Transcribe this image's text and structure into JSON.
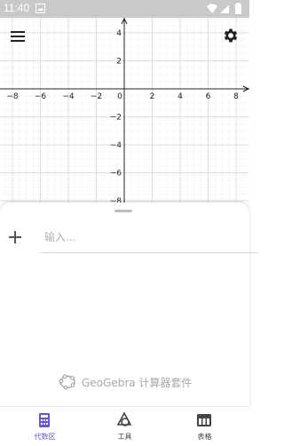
{
  "status_bar": {
    "time": "11:40",
    "icons": [
      "image-icon",
      "wifi-icon",
      "signal-icon",
      "battery-icon"
    ]
  },
  "toolbar": {
    "menu_icon": "hamburger-menu-icon",
    "settings_icon": "gear-icon"
  },
  "graph": {
    "x_ticks": [
      "−8",
      "−6",
      "−4",
      "−2",
      "0",
      "2",
      "4",
      "6",
      "8"
    ],
    "y_ticks": [
      "4",
      "2",
      "−2",
      "−4",
      "−6",
      "−8"
    ],
    "x_range": [
      -8.5,
      8.5
    ],
    "y_range": [
      -8.5,
      5.5
    ],
    "grid": true
  },
  "algebra": {
    "add_icon": "plus-icon",
    "input_placeholder": "输入..."
  },
  "branding": {
    "logo_icon": "geogebra-logo-icon",
    "text": "GeoGebra 计算器套件"
  },
  "bottom_nav": [
    {
      "label": "代数区",
      "icon": "calculator-icon",
      "active": true
    },
    {
      "label": "工具",
      "icon": "tools-icon",
      "active": false
    },
    {
      "label": "表格",
      "icon": "table-icon",
      "active": false
    }
  ],
  "colors": {
    "accent": "#6557d2",
    "status_bar": "#c9c9c9",
    "grid_minor": "#eeeeee",
    "grid_major": "#d6d6d6",
    "axis": "#222222"
  }
}
